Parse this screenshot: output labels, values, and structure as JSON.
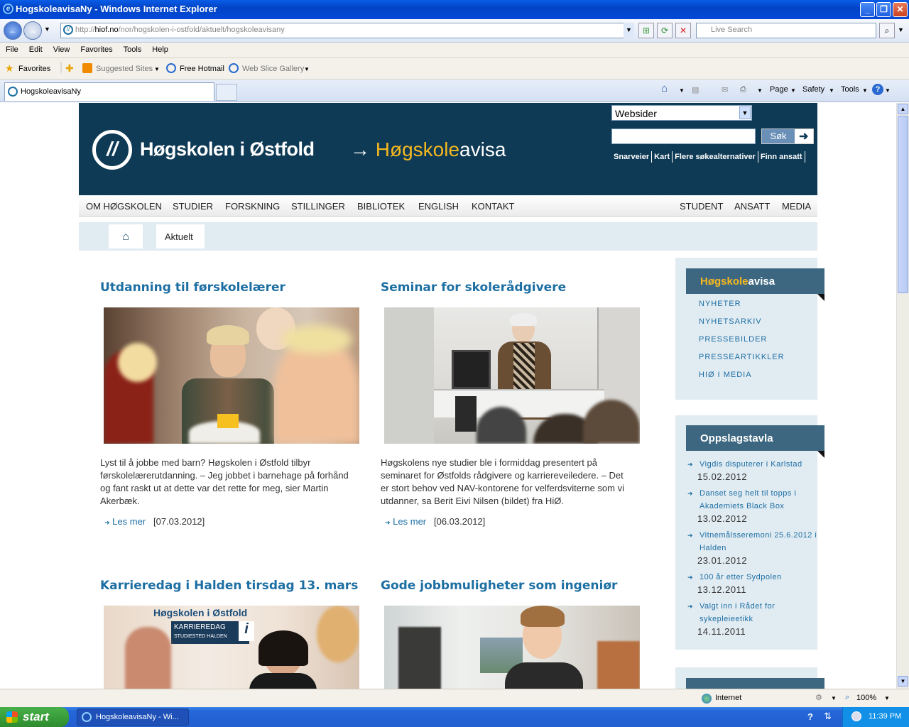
{
  "window": {
    "title": "HogskoleavisaNy - Windows Internet Explorer"
  },
  "address": {
    "prefix": "http://",
    "host": "hiof.no",
    "path": "/nor/hogskolen-i-ostfold/aktuelt/hogskoleavisany"
  },
  "live_search": {
    "placeholder": "Live Search"
  },
  "menu": [
    "File",
    "Edit",
    "View",
    "Favorites",
    "Tools",
    "Help"
  ],
  "favbar": {
    "favorites": "Favorites",
    "suggested": "Suggested Sites",
    "hotmail": "Free Hotmail",
    "webslice": "Web Slice Gallery"
  },
  "tab": {
    "title": "HogskoleavisaNy"
  },
  "cmdbar": {
    "page": "Page",
    "safety": "Safety",
    "tools": "Tools"
  },
  "site": {
    "brand_main": "Høgskolen i Østfold",
    "brand_arrow": "→",
    "brand_y": "Høgskole",
    "brand_rest": "avisa",
    "search_select": "Websider",
    "search_button": "Søk",
    "quicklinks": [
      "Snarveier",
      "Kart",
      "Flere søkealternativer",
      "Finn ansatt"
    ],
    "nav_left": [
      "OM HØGSKOLEN",
      "STUDIER",
      "FORSKNING",
      "STILLINGER",
      "BIBLIOTEK",
      "ENGLISH",
      "KONTAKT"
    ],
    "nav_right": [
      "STUDENT",
      "ANSATT",
      "MEDIA"
    ],
    "breadcrumb": "Aktuelt"
  },
  "articles": [
    {
      "title": "Utdanning til førskolelærer",
      "text": "Lyst til å jobbe med barn? Høgskolen i Østfold tilbyr førskolelærerutdanning. – Jeg jobbet i barnehage på forhånd og fant raskt ut at dette var det rette for meg, sier Martin Akerbæk.",
      "more": "Les mer",
      "date": "[07.03.2012]"
    },
    {
      "title": "Seminar for skolerådgivere",
      "text": "Høgskolens nye studier ble i formiddag presentert på seminaret for Østfolds rådgivere og karriereveiledere. – Det er stort behov ved NAV-kontorene for velferdsviterne som vi utdanner, sa Berit Eivi Nilsen (bildet) fra HiØ.",
      "more": "Les mer",
      "date": "[06.03.2012]"
    },
    {
      "title": "Karrieredag i Halden tirsdag 13. mars",
      "banner_org": "Høgskolen i Østfold",
      "banner_l1": "KARRIEREDAG",
      "banner_l2": "STUDIESTED HALDEN"
    },
    {
      "title": "Gode jobbmuligheter som ingeniør"
    }
  ],
  "sidebar": {
    "avisa_y": "Høgskole",
    "avisa_rest": "avisa",
    "links": [
      "NYHETER",
      "NYHETSARKIV",
      "PRESSEBILDER",
      "PRESSEARTIKKLER",
      "HIØ I MEDIA"
    ],
    "board_title": "Oppslagstavla",
    "notices": [
      {
        "t": "Vigdis disputerer i Karlstad",
        "d": "15.02.2012"
      },
      {
        "t": "Danset seg helt til topps i Akademiets Black Box",
        "d": "13.02.2012"
      },
      {
        "t": "Vitnemålsseremoni 25.6.2012 i Halden",
        "d": "23.01.2012"
      },
      {
        "t": "100 år etter Sydpolen",
        "d": "13.12.2011"
      },
      {
        "t": "Valgt inn i Rådet for sykepleieetikk",
        "d": "14.11.2011"
      }
    ]
  },
  "status": {
    "zone": "Internet",
    "zoom": "100%"
  },
  "taskbar": {
    "start": "start",
    "task": "HogskoleavisaNy - Wi...",
    "clock": "11:39 PM"
  }
}
